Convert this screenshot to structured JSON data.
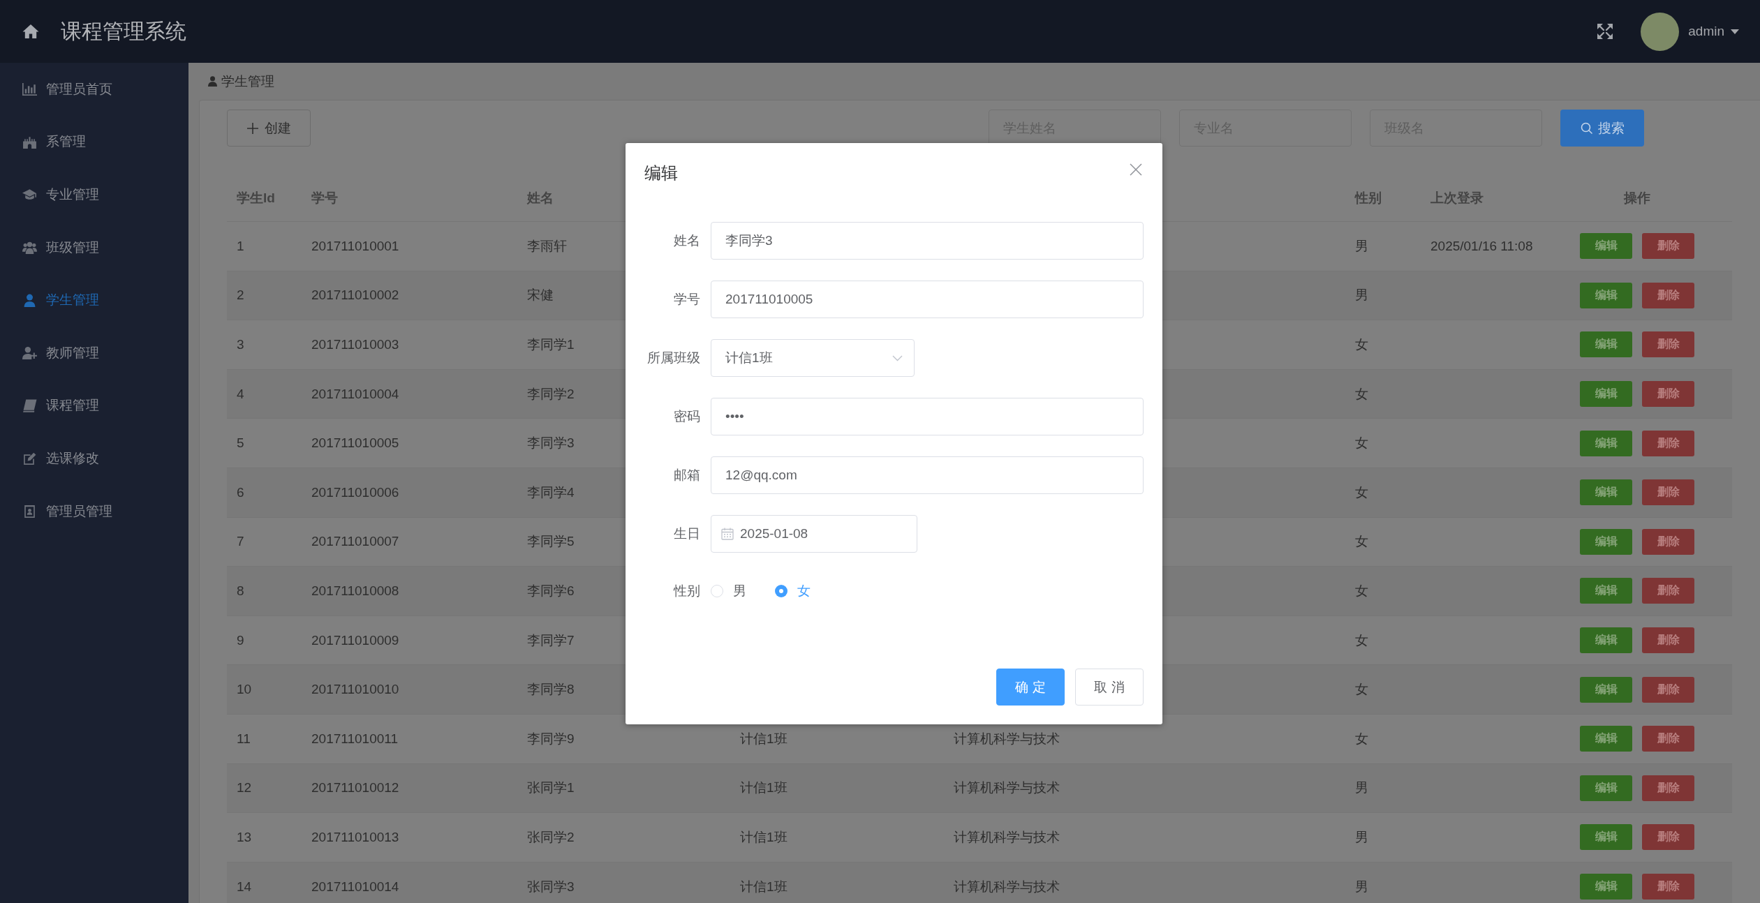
{
  "header": {
    "title": "课程管理系统",
    "user": "admin"
  },
  "sidebar": {
    "items": [
      {
        "label": "管理员首页",
        "selected": false
      },
      {
        "label": "系管理",
        "selected": false
      },
      {
        "label": "专业管理",
        "selected": false
      },
      {
        "label": "班级管理",
        "selected": false
      },
      {
        "label": "学生管理",
        "selected": true
      },
      {
        "label": "教师管理",
        "selected": false
      },
      {
        "label": "课程管理",
        "selected": false
      },
      {
        "label": "选课修改",
        "selected": false
      },
      {
        "label": "管理员管理",
        "selected": false
      }
    ]
  },
  "breadcrumb": {
    "label": "学生管理"
  },
  "toolbar": {
    "create_button": "创建",
    "search_fields": [
      {
        "placeholder": "学生姓名"
      },
      {
        "placeholder": "专业名"
      },
      {
        "placeholder": "班级名"
      }
    ],
    "search_button": "搜索"
  },
  "table": {
    "columns": [
      "学生Id",
      "学号",
      "姓名",
      "性别",
      "上次登录",
      "操作"
    ],
    "rows": [
      {
        "id": "1",
        "student_no": "201711010001",
        "name": "李雨轩",
        "gender": "男",
        "last_login": "2025/01/16 11:08",
        "actions": [
          {
            "label": "编辑",
            "kind": "edit"
          },
          {
            "label": "删除",
            "kind": "delete"
          }
        ]
      },
      {
        "id": "2",
        "student_no": "201711010002",
        "name": "宋健",
        "gender": "男",
        "actions": [
          {
            "label": "编辑",
            "kind": "edit"
          },
          {
            "label": "删除",
            "kind": "delete"
          }
        ]
      },
      {
        "id": "3",
        "student_no": "201711010003",
        "name": "李同学1",
        "gender": "女",
        "actions": [
          {
            "label": "编辑",
            "kind": "edit"
          },
          {
            "label": "删除",
            "kind": "delete"
          }
        ]
      },
      {
        "id": "4",
        "student_no": "201711010004",
        "name": "李同学2",
        "gender": "女",
        "actions": [
          {
            "label": "编辑",
            "kind": "edit"
          },
          {
            "label": "删除",
            "kind": "delete"
          }
        ]
      },
      {
        "id": "5",
        "student_no": "201711010005",
        "name": "李同学3",
        "gender": "女",
        "actions": [
          {
            "label": "编辑",
            "kind": "edit"
          },
          {
            "label": "删除",
            "kind": "delete"
          }
        ]
      },
      {
        "id": "6",
        "student_no": "201711010006",
        "name": "李同学4",
        "gender": "女",
        "actions": [
          {
            "label": "编辑",
            "kind": "edit"
          },
          {
            "label": "删除",
            "kind": "delete"
          }
        ]
      },
      {
        "id": "7",
        "student_no": "201711010007",
        "name": "李同学5",
        "gender": "女",
        "actions": [
          {
            "label": "编辑",
            "kind": "edit"
          },
          {
            "label": "删除",
            "kind": "delete"
          }
        ]
      },
      {
        "id": "8",
        "student_no": "201711010008",
        "name": "李同学6",
        "gender": "女",
        "actions": [
          {
            "label": "编辑",
            "kind": "edit"
          },
          {
            "label": "删除",
            "kind": "delete"
          }
        ]
      },
      {
        "id": "9",
        "student_no": "201711010009",
        "name": "李同学7",
        "gender": "女",
        "actions": [
          {
            "label": "编辑",
            "kind": "edit"
          },
          {
            "label": "删除",
            "kind": "delete"
          }
        ]
      },
      {
        "id": "10",
        "student_no": "201711010010",
        "name": "李同学8",
        "gender": "女",
        "actions": [
          {
            "label": "编辑",
            "kind": "edit"
          },
          {
            "label": "删除",
            "kind": "delete"
          }
        ]
      },
      {
        "id": "11",
        "student_no": "201711010011",
        "name": "李同学9",
        "column_4": "计信1班",
        "column_5": "计算机科学与技术",
        "gender": "女",
        "actions": [
          {
            "label": "编辑",
            "kind": "edit"
          },
          {
            "label": "删除",
            "kind": "delete"
          }
        ]
      },
      {
        "id": "12",
        "student_no": "201711010012",
        "name": "张同学1",
        "column_4": "计信1班",
        "column_5": "计算机科学与技术",
        "gender": "男",
        "actions": [
          {
            "label": "编辑",
            "kind": "edit"
          },
          {
            "label": "删除",
            "kind": "delete"
          }
        ]
      },
      {
        "id": "13",
        "student_no": "201711010013",
        "name": "张同学2",
        "column_4": "计信1班",
        "column_5": "计算机科学与技术",
        "gender": "男",
        "actions": [
          {
            "label": "编辑",
            "kind": "edit"
          },
          {
            "label": "删除",
            "kind": "delete"
          }
        ]
      },
      {
        "id": "14",
        "student_no": "201711010014",
        "name": "张同学3",
        "column_4": "计信1班",
        "column_5": "计算机科学与技术",
        "gender": "男",
        "actions": [
          {
            "label": "编辑",
            "kind": "edit"
          },
          {
            "label": "删除",
            "kind": "delete"
          }
        ]
      }
    ]
  },
  "dialog": {
    "title": "编辑",
    "fields": [
      {
        "kind": "text",
        "label": "姓名",
        "value": "李同学3"
      },
      {
        "kind": "text",
        "label": "学号",
        "value": "201711010005"
      },
      {
        "kind": "select",
        "label": "所属班级",
        "value": "计信1班"
      },
      {
        "kind": "password",
        "label": "密码",
        "value": "••••"
      },
      {
        "kind": "text",
        "label": "邮箱",
        "value": "12@qq.com"
      },
      {
        "kind": "date",
        "label": "生日",
        "value": "2025-01-08"
      },
      {
        "kind": "radio",
        "label": "性别",
        "options": [
          {
            "label": "男",
            "selected": false
          },
          {
            "label": "女",
            "selected": true
          }
        ]
      }
    ],
    "buttons": [
      {
        "label": "确 定",
        "kind": "confirm"
      },
      {
        "label": "取 消",
        "kind": "cancel"
      }
    ]
  }
}
